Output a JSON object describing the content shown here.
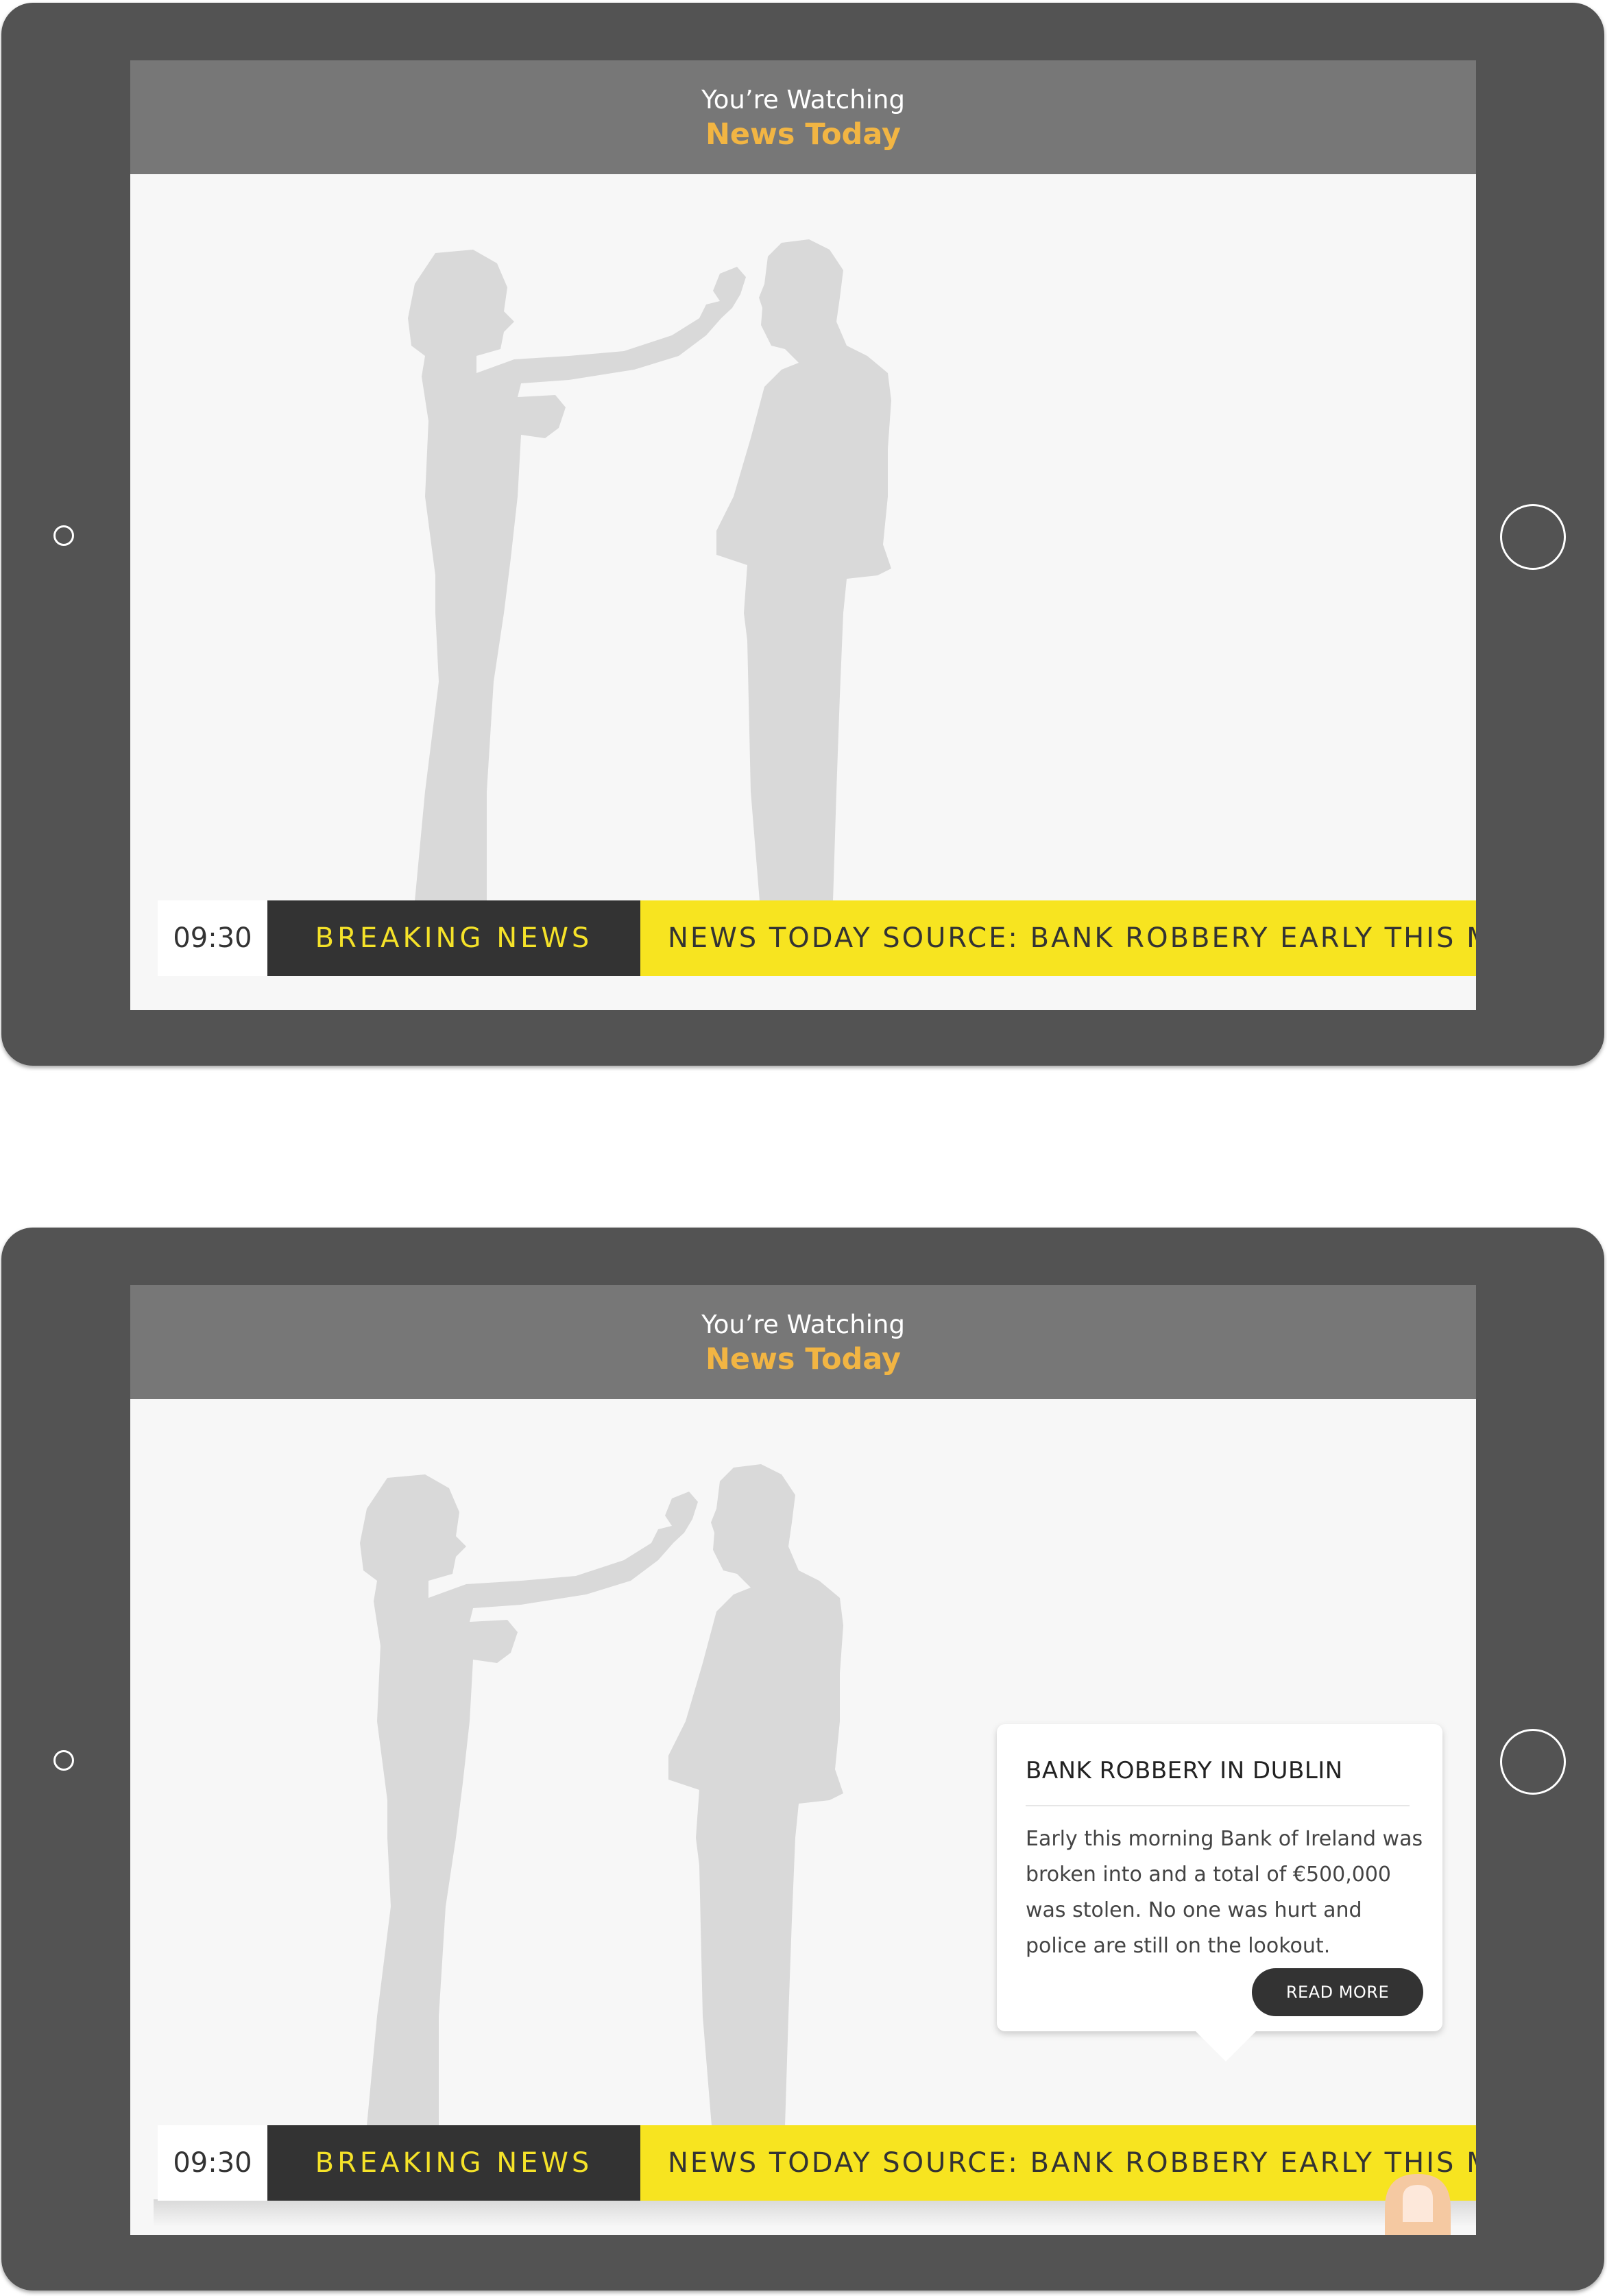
{
  "colors": {
    "device": "#535353",
    "screen_bg": "#f7f7f7",
    "topbar": "#777777",
    "channel_accent": "#f2b543",
    "ticker_yellow": "#f7e420",
    "ticker_dark": "#333333",
    "silhouette": "#d9d9d9",
    "finger": "#f5c9a2"
  },
  "screens": [
    {
      "header": {
        "watching_label": "You’re Watching",
        "channel_name": "News Today"
      },
      "ticker": {
        "time": "09:30",
        "label": "BREAKING NEWS",
        "headline": "NEWS TODAY SOURCE: BANK ROBBERY EARLY THIS MOR"
      }
    },
    {
      "header": {
        "watching_label": "You’re Watching",
        "channel_name": "News Today"
      },
      "ticker": {
        "time": "09:30",
        "label": "BREAKING NEWS",
        "headline": "NEWS TODAY SOURCE: BANK ROBBERY EARLY THIS MOR"
      },
      "popup": {
        "title": "BANK ROBBERY IN DUBLIN",
        "body": "Early this morning Bank of Ireland was broken into and a total of €500,000 was stolen. No one was hurt and police are still on the lookout.",
        "button_label": "READ MORE"
      },
      "finger_icon": "tap-finger-icon"
    }
  ]
}
